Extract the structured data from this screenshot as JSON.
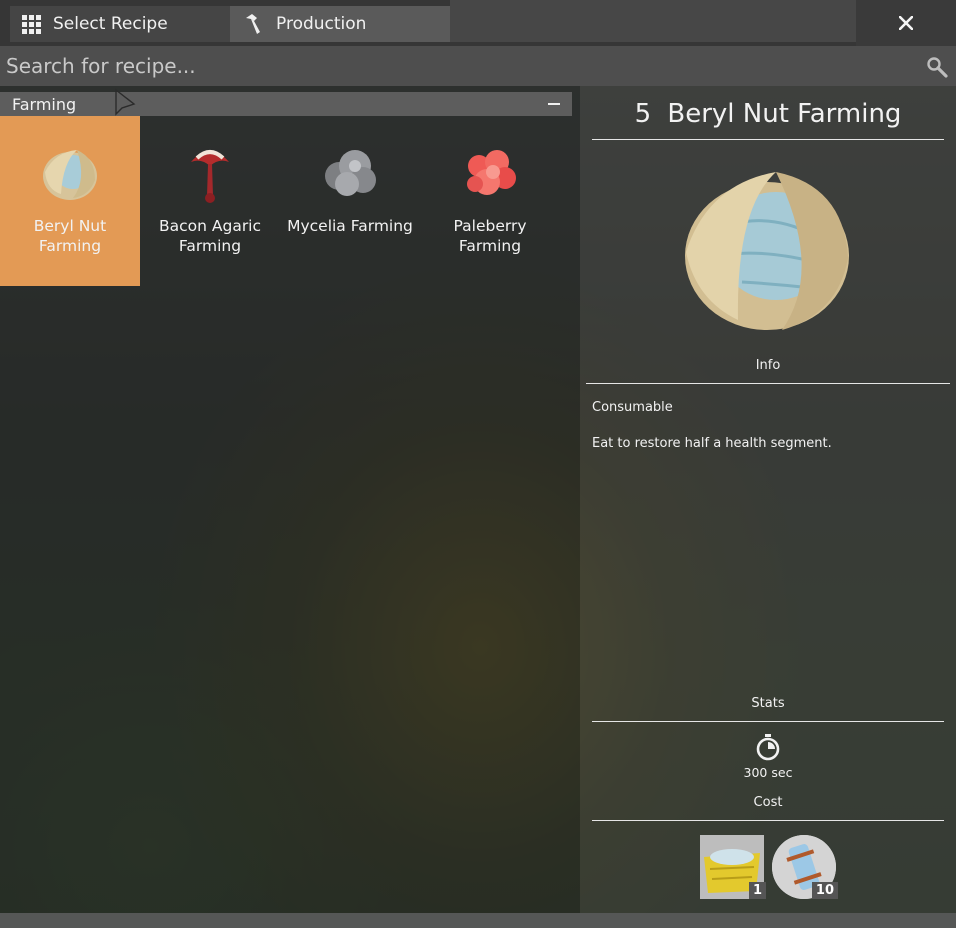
{
  "tabs": {
    "select_recipe": "Select Recipe",
    "production": "Production"
  },
  "close_label": "✕",
  "search": {
    "placeholder": "Search for recipe..."
  },
  "category": {
    "name": "Farming",
    "collapse_glyph": "–"
  },
  "recipes": [
    {
      "label": "Beryl Nut Farming",
      "icon": "beryl-nut-icon",
      "selected": true
    },
    {
      "label": "Bacon Agaric Farming",
      "icon": "bacon-agaric-icon",
      "selected": false
    },
    {
      "label": "Mycelia Farming",
      "icon": "mycelia-icon",
      "selected": false
    },
    {
      "label": "Paleberry Farming",
      "icon": "paleberry-icon",
      "selected": false
    }
  ],
  "detail": {
    "quantity": "5",
    "title": "Beryl Nut Farming",
    "info_heading": "Info",
    "info_type": "Consumable",
    "info_description": "Eat to restore half a health segment.",
    "stats_heading": "Stats",
    "time": "300 sec",
    "cost_heading": "Cost",
    "cost": [
      {
        "icon": "beryl-nut-crate-icon",
        "count": "1"
      },
      {
        "icon": "water-canister-icon",
        "count": "10"
      }
    ]
  },
  "colors": {
    "selected_recipe": "#e39a55",
    "panel_dark": "#363636",
    "text": "#f2f2f2"
  }
}
